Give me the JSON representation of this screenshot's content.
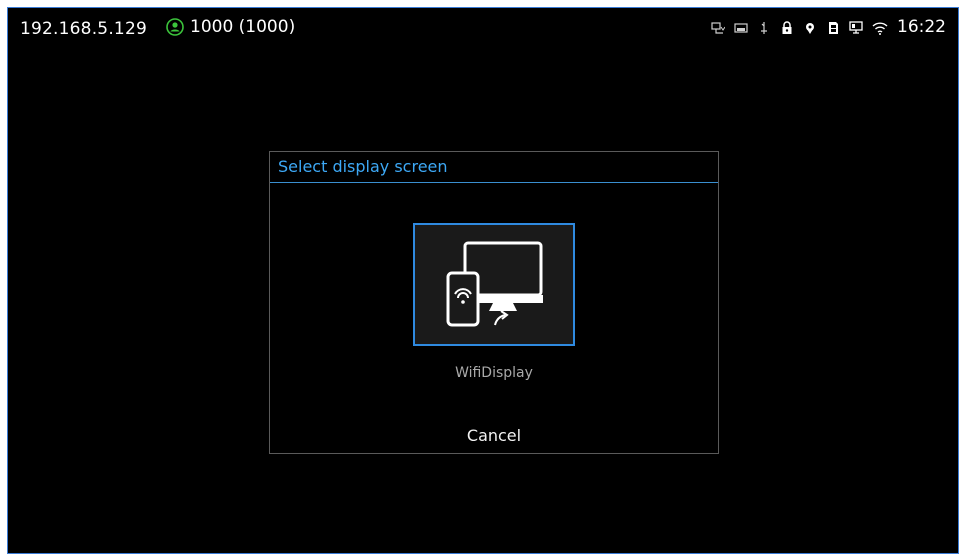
{
  "statusbar": {
    "ip_address": "192.168.5.129",
    "account_icon": "account-icon",
    "account_status": "1000 (1000)",
    "icons": [
      "network-icon",
      "screen-icon",
      "usb-icon",
      "lock-icon",
      "location-icon",
      "sdcard-icon",
      "display-icon",
      "wifi-icon"
    ],
    "time": "16:22",
    "colors": {
      "account_green": "#3cc43c"
    }
  },
  "dialog": {
    "title": "Select display screen",
    "option": {
      "icon": "wifi-display-icon",
      "label": "WifiDisplay"
    },
    "cancel_label": "Cancel",
    "colors": {
      "title": "#3da8f5",
      "selection_border": "#2f8ae0"
    }
  }
}
